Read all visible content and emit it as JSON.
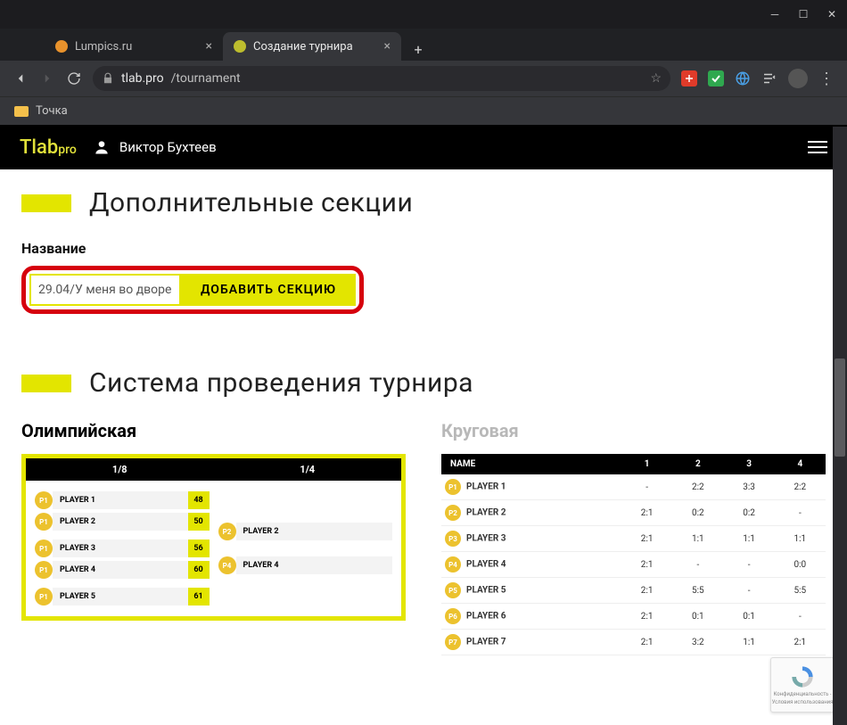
{
  "window": {
    "tabs": [
      {
        "title": "Lumpics.ru",
        "icon_color": "#e8922c",
        "active": false
      },
      {
        "title": "Создание турнира",
        "icon_color": "#e3e500",
        "active": true
      }
    ],
    "url_host": "tlab.pro",
    "url_path": "/tournament",
    "bookmark_folder": "Точка"
  },
  "site": {
    "logo_main": "Tlab",
    "logo_sub": "pro",
    "user_name": "Виктор Бухтеев"
  },
  "sections": {
    "additional_title": "Дополнительные секции",
    "name_label": "Название",
    "name_value": "29.04/У меня во дворе",
    "add_button": "ДОБАВИТЬ СЕКЦИЮ",
    "system_title": "Система проведения турнира"
  },
  "systems": {
    "olympic_label": "Олимпийская",
    "round_label": "Круговая"
  },
  "bracket": {
    "round1_label": "1/8",
    "round2_label": "1/4",
    "col1": [
      {
        "badge": "P1",
        "name": "PLAYER 1",
        "score": "48"
      },
      {
        "badge": "P1",
        "name": "PLAYER 2",
        "score": "50"
      },
      {
        "badge": "P1",
        "name": "PLAYER 3",
        "score": "56"
      },
      {
        "badge": "P1",
        "name": "PLAYER 4",
        "score": "60"
      },
      {
        "badge": "P1",
        "name": "PLAYER 5",
        "score": "61"
      }
    ],
    "col2": [
      {
        "badge": "P2",
        "name": "PLAYER 2"
      },
      {
        "badge": "P4",
        "name": "PLAYER 4"
      }
    ]
  },
  "round_table": {
    "head_name": "NAME",
    "cols": [
      "1",
      "2",
      "3",
      "4"
    ],
    "rows": [
      {
        "badge": "P1",
        "name": "PLAYER 1",
        "cells": [
          "-",
          "2:2",
          "3:3",
          "2:2"
        ]
      },
      {
        "badge": "P2",
        "name": "PLAYER 2",
        "cells": [
          "2:1",
          "0:2",
          "0:2",
          "-"
        ]
      },
      {
        "badge": "P3",
        "name": "PLAYER 3",
        "cells": [
          "2:1",
          "1:1",
          "1:1",
          "1:1"
        ]
      },
      {
        "badge": "P4",
        "name": "PLAYER 4",
        "cells": [
          "2:1",
          "-",
          "-",
          "0:0"
        ]
      },
      {
        "badge": "P5",
        "name": "PLAYER 5",
        "cells": [
          "2:1",
          "5:5",
          "-",
          "5:5"
        ]
      },
      {
        "badge": "P6",
        "name": "PLAYER 6",
        "cells": [
          "2:1",
          "0:1",
          "0:1",
          "-"
        ]
      },
      {
        "badge": "P7",
        "name": "PLAYER 7",
        "cells": [
          "2:1",
          "3:2",
          "1:1",
          "2:1"
        ]
      }
    ]
  },
  "recaptcha": {
    "line1": "Конфиденциальность -",
    "line2": "Условия использования"
  }
}
